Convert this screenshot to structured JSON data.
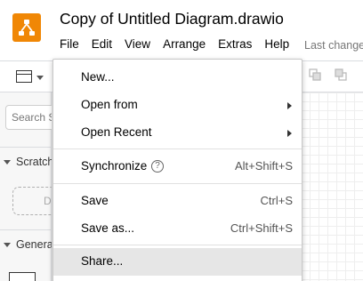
{
  "header": {
    "title": "Copy of Untitled Diagram.drawio",
    "menu": [
      "File",
      "Edit",
      "View",
      "Arrange",
      "Extras",
      "Help"
    ],
    "last_change": "Last change"
  },
  "sidebar": {
    "search_placeholder": "Search S",
    "scratchpad_label": "Scratch",
    "scratchpad_drop": "D",
    "general_label": "Genera"
  },
  "file_menu": {
    "new": "New...",
    "open_from": "Open from",
    "open_recent": "Open Recent",
    "synchronize": "Synchronize",
    "synchronize_help": "?",
    "synchronize_shortcut": "Alt+Shift+S",
    "save": "Save",
    "save_shortcut": "Ctrl+S",
    "save_as": "Save as...",
    "save_as_shortcut": "Ctrl+Shift+S",
    "share": "Share..."
  },
  "colors": {
    "logo": "#f08705",
    "menu_highlight": "#e6e6e6"
  }
}
